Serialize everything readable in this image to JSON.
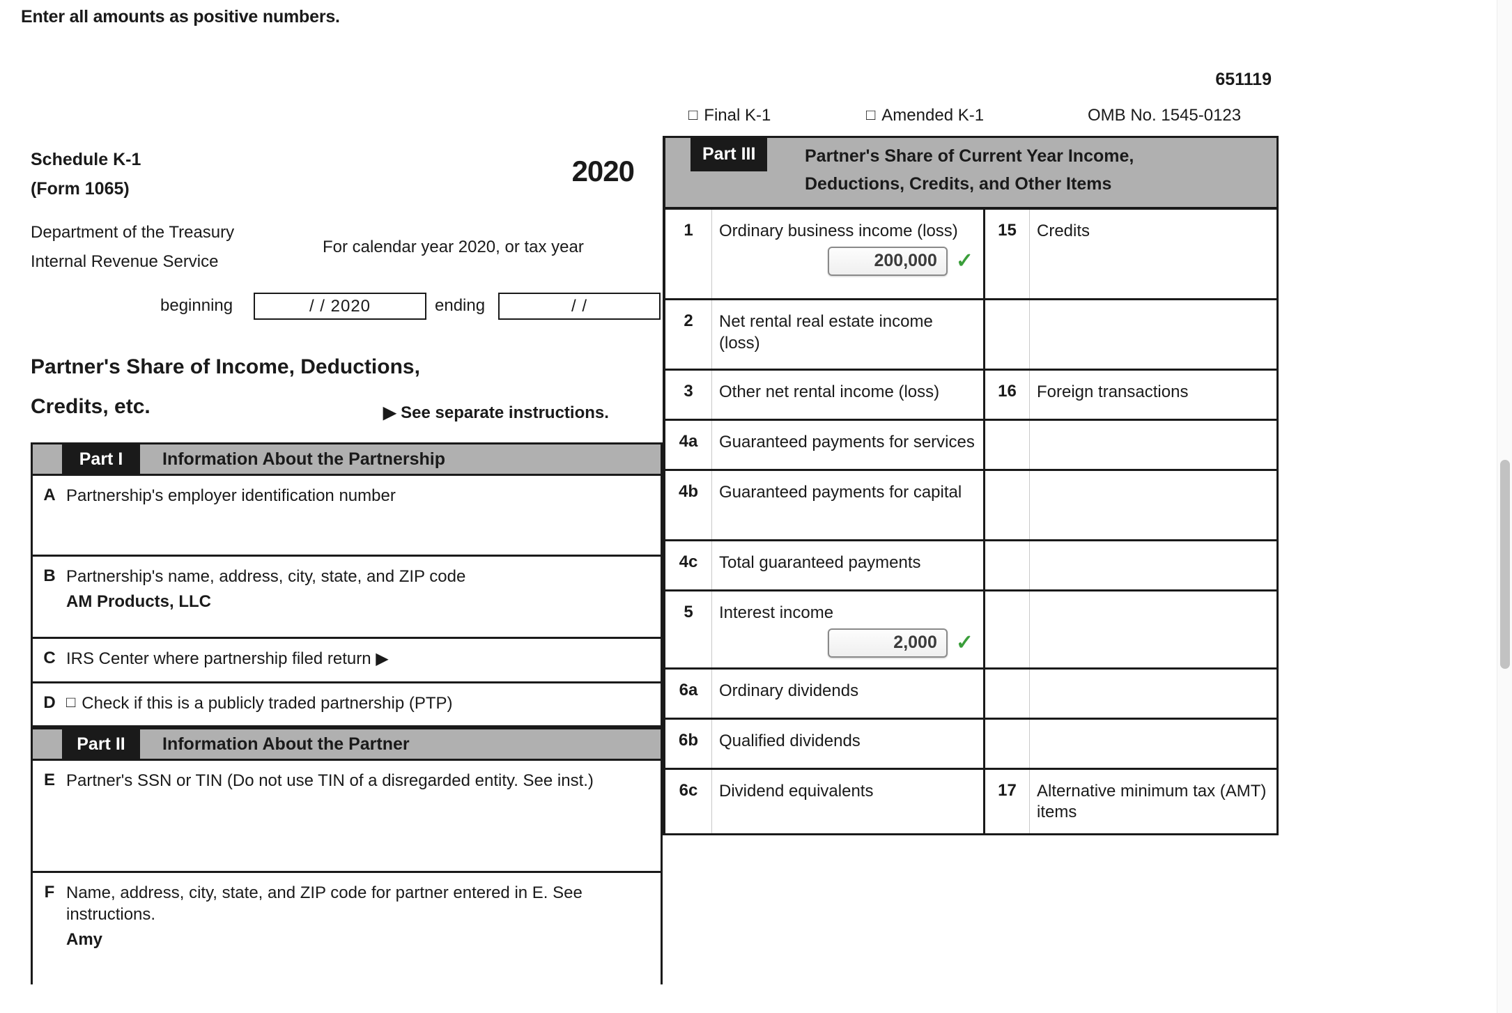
{
  "banner": "Enter all amounts as positive numbers.",
  "form_number": "651119",
  "header": {
    "final_k1": "Final K-1",
    "amended_k1": "Amended K-1",
    "omb": "OMB No. 1545-0123",
    "checkbox_glyph": "□"
  },
  "left": {
    "schedule": "Schedule K-1",
    "form": "(Form 1065)",
    "year": "2020",
    "dept_line1": "Department of the Treasury",
    "dept_line2": "Internal Revenue Service",
    "calendar_year": "For calendar year 2020, or tax year",
    "beginning_label": "beginning",
    "beginning_value": "/          / 2020",
    "ending_label": "ending",
    "ending_value": "/          /",
    "title_line1": "Partner's Share of Income, Deductions,",
    "title_line2": "Credits, etc.",
    "see_instructions": "▶ See separate instructions."
  },
  "part1": {
    "tag": "Part I",
    "title": "Information About the Partnership",
    "rows": [
      {
        "letter": "A",
        "label": "Partnership's employer identification number",
        "value": ""
      },
      {
        "letter": "B",
        "label": "Partnership's name, address, city, state, and ZIP code",
        "value": "AM Products, LLC"
      },
      {
        "letter": "C",
        "label": "IRS Center where partnership filed return ▶",
        "value": ""
      },
      {
        "letter": "D",
        "label": "Check if this is a publicly traded partnership (PTP)",
        "value": "",
        "checkbox": true
      }
    ]
  },
  "part2": {
    "tag": "Part II",
    "title": "Information About the Partner",
    "rows": [
      {
        "letter": "E",
        "label": "Partner's SSN or TIN (Do not use TIN of a disregarded entity. See inst.)",
        "value": ""
      },
      {
        "letter": "F",
        "label": "Name, address, city, state, and ZIP code for partner entered in E. See instructions.",
        "value": "Amy"
      }
    ]
  },
  "part3": {
    "tag": "Part III",
    "title_line1": "Partner's Share of Current Year Income,",
    "title_line2": "Deductions, Credits, and Other Items",
    "rows": [
      {
        "num": "1",
        "desc": "Ordinary business income (loss)",
        "amount": "200,000",
        "validated": true,
        "rnum": "15",
        "rdesc": "Credits"
      },
      {
        "num": "2",
        "desc": "Net rental real estate income (loss)",
        "amount": "",
        "validated": false,
        "rnum": "",
        "rdesc": ""
      },
      {
        "num": "3",
        "desc": "Other net rental income (loss)",
        "amount": "",
        "validated": false,
        "rnum": "16",
        "rdesc": "Foreign transactions"
      },
      {
        "num": "4a",
        "desc": "Guaranteed payments for services",
        "amount": "",
        "validated": false,
        "rnum": "",
        "rdesc": ""
      },
      {
        "num": "4b",
        "desc": "Guaranteed payments for capital",
        "amount": "",
        "validated": false,
        "rnum": "",
        "rdesc": ""
      },
      {
        "num": "4c",
        "desc": "Total guaranteed payments",
        "amount": "",
        "validated": false,
        "rnum": "",
        "rdesc": ""
      },
      {
        "num": "5",
        "desc": "Interest income",
        "amount": "2,000",
        "validated": true,
        "rnum": "",
        "rdesc": ""
      },
      {
        "num": "6a",
        "desc": "Ordinary dividends",
        "amount": "",
        "validated": false,
        "rnum": "",
        "rdesc": ""
      },
      {
        "num": "6b",
        "desc": "Qualified dividends",
        "amount": "",
        "validated": false,
        "rnum": "",
        "rdesc": ""
      },
      {
        "num": "6c",
        "desc": "Dividend equivalents",
        "amount": "",
        "validated": false,
        "rnum": "17",
        "rdesc": "Alternative minimum tax (AMT) items"
      }
    ],
    "checkmark_glyph": "✓"
  },
  "colors": {
    "part_band": "#b0b0b0",
    "part_tag": "#1a1a1a",
    "check_green": "#3a9e3a",
    "ink": "#1a1a1a"
  }
}
